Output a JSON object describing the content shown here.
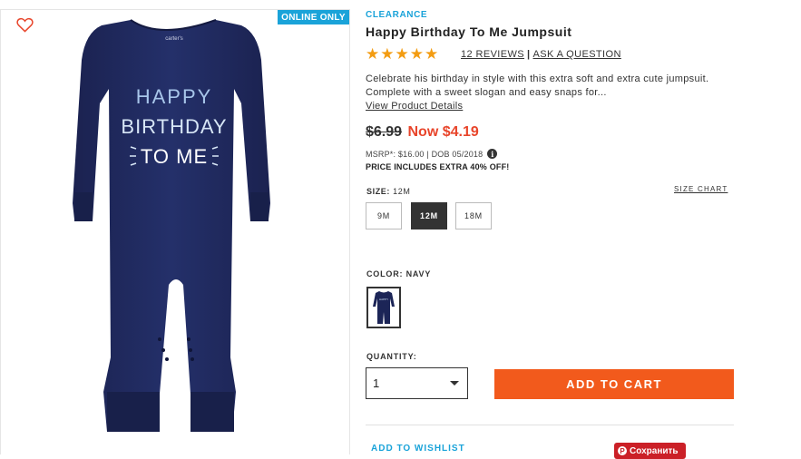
{
  "product": {
    "badge": "ONLINE ONLY",
    "category": "CLEARANCE",
    "title": "Happy Birthday To Me Jumpsuit",
    "rating_stars": "★★★★★",
    "reviews_link": "12 REVIEWS",
    "separator": "|",
    "ask_link": "ASK A QUESTION",
    "description": "Celebrate his birthday in style with this extra soft and extra cute jumpsuit. Complete with a sweet slogan and easy snaps for...",
    "details_link": "View Product Details",
    "image_text": [
      "HAPPY",
      "BIRTHDAY",
      "TO ME"
    ],
    "label_text": "carter's"
  },
  "price": {
    "was": "$6.99",
    "now": "Now $4.19",
    "msrp": "MSRP*: $16.00 | DOB 05/2018",
    "info_icon": "i",
    "extra": "PRICE INCLUDES EXTRA 40% OFF!"
  },
  "size": {
    "label": "SIZE:",
    "selected": "12M",
    "chart_link": "SIZE CHART",
    "options": [
      "9M",
      "12M",
      "18M"
    ]
  },
  "color": {
    "label": "COLOR: NAVY",
    "navy_hex": "#1c2557"
  },
  "quantity": {
    "label": "QUANTITY:",
    "value": "1"
  },
  "actions": {
    "add_to_cart": "ADD TO CART",
    "wishlist": "ADD TO WISHLIST",
    "pin": "Сохранить",
    "pin_icon": "P"
  },
  "colors": {
    "accent_blue": "#1aa3d9",
    "price_red": "#e8452b",
    "cart_orange": "#f25a1c",
    "star_gold": "#f39c12"
  }
}
